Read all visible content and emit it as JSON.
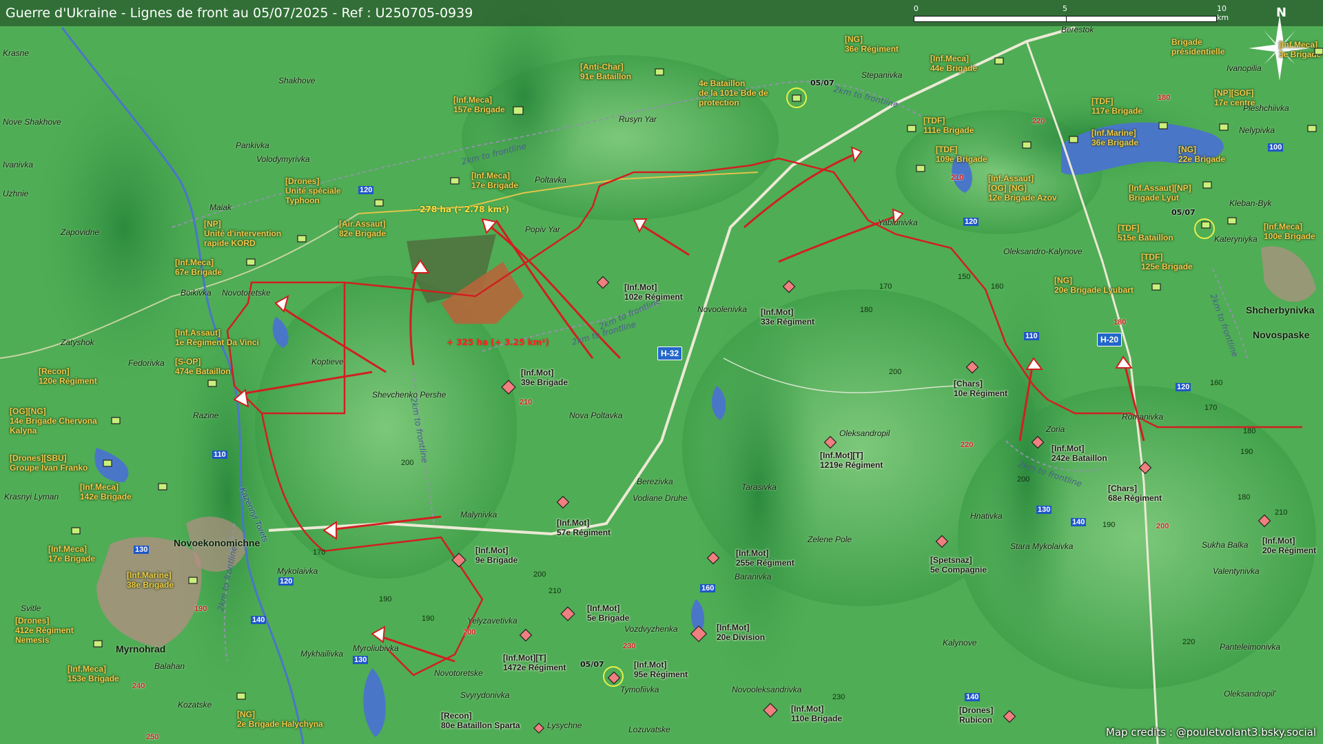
{
  "title": "Guerre d'Ukraine - Lignes de front au 05/07/2025 - Ref : U250705-0939",
  "scale": {
    "t0": "0",
    "t5": "5",
    "t10": "10 km"
  },
  "north": "N",
  "credits": "Map credits : @pouletvolant3.bsky.social",
  "colors": {
    "frontline": "#d11f1f",
    "ukrainian_labels": "#f2c94c",
    "russian_labels": "#1a1a1a",
    "road_numbers": "#1f56c7",
    "highway_shield": "#2467c9"
  },
  "annotations": {
    "loss": "- 278 ha (- 2.78 km²)",
    "gain": "+ 325 ha (+ 3.25 km²)",
    "date1": "05/07",
    "date2": "05/07",
    "date3": "05/07"
  },
  "frontline_labels": [
    "2km to frontline",
    "2km to frontline",
    "2km to frontline",
    "2km to frontline",
    "2km to frontline",
    "2km to frontline",
    "2km to frontline",
    "2km to frontline"
  ],
  "highways": [
    "H-32",
    "H-20"
  ],
  "ua_units": [
    {
      "line1": "[NG]",
      "line2": "36e Régiment"
    },
    {
      "line1": "[Inf.Meca]",
      "line2": "44e Brigade"
    },
    {
      "line1": "Brigade",
      "line2": "présidentielle"
    },
    {
      "line1": "[Inf.Meca]",
      "line2": "3e Brigade"
    },
    {
      "line1": "[Anti-Char]",
      "line2": "91e Bataillon"
    },
    {
      "line1": "4e Bataillon",
      "line2": "de la 101e Bde de",
      "line3": "protection"
    },
    {
      "line1": "[Inf.Meca]",
      "line2": "157e Brigade"
    },
    {
      "line1": "[TDF]",
      "line2": "117e Brigade"
    },
    {
      "line1": "[NP][SOF]",
      "line2": "17e centre"
    },
    {
      "line1": "[TDF]",
      "line2": "111e Brigade"
    },
    {
      "line1": "[Inf.Marine]",
      "line2": "36e Brigade"
    },
    {
      "line1": "[NG]",
      "line2": "22e Brigade"
    },
    {
      "line1": "[TDF]",
      "line2": "109e Brigade"
    },
    {
      "line1": "[Drones]",
      "line2": "Unité spéciale",
      "line3": "Typhoon"
    },
    {
      "line1": "[Inf.Meca]",
      "line2": "17e Brigade"
    },
    {
      "line1": "[Inf.Assaut]",
      "line2": "[OG] [NG]",
      "line3": "12e Brigade Azov"
    },
    {
      "line1": "[Inf.Assaut][NP]",
      "line2": "Brigade Lyut"
    },
    {
      "line1": "[NP]",
      "line2": "Unité d'intervention",
      "line3": "rapide KORD"
    },
    {
      "line1": "[Air.Assaut]",
      "line2": "82e Brigade"
    },
    {
      "line1": "[TDF]",
      "line2": "515e Bataillon"
    },
    {
      "line1": "[Inf.Meca]",
      "line2": "100e Brigade"
    },
    {
      "line1": "[Inf.Meca]",
      "line2": "67e Brigade"
    },
    {
      "line1": "[TDF]",
      "line2": "125e Brigade"
    },
    {
      "line1": "[NG]",
      "line2": "20e Brigade Lyubart"
    },
    {
      "line1": "[Inf.Assaut]",
      "line2": "1e Régiment Da Vinci"
    },
    {
      "line1": "[S-OP]",
      "line2": "474e Bataillon"
    },
    {
      "line1": "[Recon]",
      "line2": "120e Régiment"
    },
    {
      "line1": "[OG][NG]",
      "line2": "14e Brigade Chervona",
      "line3": "Kalyna"
    },
    {
      "line1": "[Drones][SBU]",
      "line2": "Groupe Ivan Franko"
    },
    {
      "line1": "[Inf.Meca]",
      "line2": "142e Brigade"
    },
    {
      "line1": "[Inf.Meca]",
      "line2": "17e Brigade"
    },
    {
      "line1": "[Inf.Marine]",
      "line2": "38e Brigade"
    },
    {
      "line1": "[Drones]",
      "line2": "412e Régiment",
      "line3": "Nemesis"
    },
    {
      "line1": "[Inf.Meca]",
      "line2": "153e Brigade"
    },
    {
      "line1": "[NG]",
      "line2": "2e Brigade Halychyna"
    }
  ],
  "ru_units": [
    {
      "line1": "[Inf.Mot]",
      "line2": "102e Régiment"
    },
    {
      "line1": "[Inf.Mot]",
      "line2": "33e Régiment"
    },
    {
      "line1": "[Inf.Mot]",
      "line2": "39e Brigade"
    },
    {
      "line1": "[Chars]",
      "line2": "10e Régiment"
    },
    {
      "line1": "[Inf.Mot][T]",
      "line2": "1219e Régiment"
    },
    {
      "line1": "[Inf.Mot]",
      "line2": "242e Bataillon"
    },
    {
      "line1": "[Chars]",
      "line2": "68e Régiment"
    },
    {
      "line1": "[Inf.Mot]",
      "line2": "57e Régiment"
    },
    {
      "line1": "[Inf.Mot]",
      "line2": "9e Brigade"
    },
    {
      "line1": "[Inf.Mot]",
      "line2": "255e Régiment"
    },
    {
      "line1": "[Spetsnaz]",
      "line2": "5e Compagnie"
    },
    {
      "line1": "[Inf.Mot]",
      "line2": "20e Régiment"
    },
    {
      "line1": "[Inf.Mot]",
      "line2": "5e Brigade"
    },
    {
      "line1": "[Inf.Mot]",
      "line2": "20e Division"
    },
    {
      "line1": "[Inf.Mot][T]",
      "line2": "1472e Régiment"
    },
    {
      "line1": "[Inf.Mot]",
      "line2": "95e Régiment"
    },
    {
      "line1": "[Inf.Mot]",
      "line2": "110e Brigade"
    },
    {
      "line1": "[Recon]",
      "line2": "80e Bataillon Sparta"
    },
    {
      "line1": "[Drones]",
      "line2": "Rubicon"
    }
  ],
  "places": [
    "Shakhove",
    "Nove Shakhove",
    "Pankivka",
    "Volodymyrivka",
    "Maiak",
    "Zapovidne",
    "Boikivka",
    "Novotoretske",
    "Zatyshok",
    "Fedorivka",
    "Koptieve",
    "Razine",
    "Shevchenko Pershe",
    "Popiv Yar",
    "Poltavka",
    "Rusyn Yar",
    "Stepanivka",
    "Berestok",
    "Ivanopilia",
    "Pleshchiivka",
    "Nelypivka",
    "Kleban-Byk",
    "Kateryniyka",
    "Yablunivka",
    "Oleksandro-Kalynove",
    "Novoolenivka",
    "Shcherbynivka",
    "Novospaske",
    "Oleksandropil",
    "Zoria",
    "Romanivka",
    "Nova Poltavka",
    "Berezivka",
    "Vodiane Druhe",
    "Tarasivka",
    "Zelene Pole",
    "Hnativka",
    "Stara Mykolaivka",
    "Sukha Balka",
    "Valentynivka",
    "Malynivka",
    "Mykolaivka",
    "Krasnyi Lyman",
    "Novoekonomichne",
    "Svitle",
    "Myrnohrad",
    "Balahan",
    "Kozatske",
    "Mykhailivka",
    "Myroliubivka",
    "Yelyzavetivka",
    "Novotoretske",
    "Svyrydonivka",
    "Tymofiivka",
    "Lysychne",
    "Lozuvatske",
    "Vozdvyzhenka",
    "Baranivka",
    "Novooleksandrivka",
    "Kalynove",
    "Panteleimonivka",
    "Oleksandropil'",
    "Kazennyi Torets",
    "Ivanivka",
    "Uzhnie",
    "Krasne"
  ],
  "road_numbers": [
    "120",
    "130",
    "120",
    "140",
    "110",
    "130",
    "120",
    "110",
    "120",
    "100",
    "130",
    "140",
    "140",
    "160"
  ],
  "red_numbers": [
    "220",
    "210",
    "180",
    "180",
    "210",
    "190",
    "200",
    "230",
    "220",
    "200",
    "240",
    "250"
  ],
  "elevations": [
    "170",
    "180",
    "150",
    "160",
    "200",
    "200",
    "190",
    "190",
    "200",
    "210",
    "170",
    "200",
    "230",
    "220",
    "190",
    "170",
    "180",
    "160",
    "190",
    "210",
    "180"
  ]
}
